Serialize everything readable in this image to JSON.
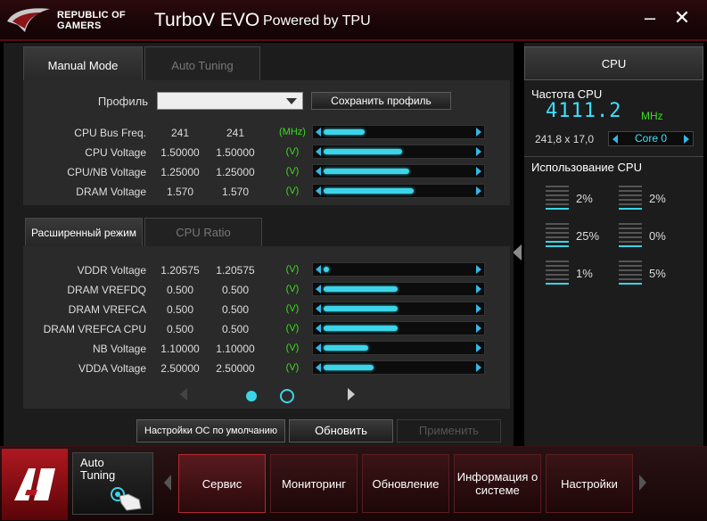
{
  "titlebar": {
    "brand": "REPUBLIC OF GAMERS",
    "brand_line1": "REPUBLIC OF",
    "brand_line2": "GAMERS",
    "title": "TurboV EVO",
    "subtitle": "Powered by TPU",
    "minimize": "–",
    "close": "✕"
  },
  "tabs": {
    "manual": "Manual Mode",
    "auto": "Auto Tuning",
    "advanced": "Расширенный режим",
    "cpu_ratio": "CPU Ratio"
  },
  "profile": {
    "label": "Профиль",
    "value": "",
    "save_button": "Сохранить профиль"
  },
  "voltages_top": [
    {
      "name": "CPU Bus Freq.",
      "value1": "241",
      "value2": "241",
      "unit": "(MHz)",
      "level": 0.28
    },
    {
      "name": "CPU Voltage",
      "value1": "1.50000",
      "value2": "1.50000",
      "unit": "(V)",
      "level": 0.53
    },
    {
      "name": "CPU/NB Voltage",
      "value1": "1.25000",
      "value2": "1.25000",
      "unit": "(V)",
      "level": 0.58
    },
    {
      "name": "DRAM Voltage",
      "value1": "1.570",
      "value2": "1.570",
      "unit": "(V)",
      "level": 0.61
    }
  ],
  "voltages_advanced": [
    {
      "name": "VDDR Voltage",
      "value1": "1.20575",
      "value2": "1.20575",
      "unit": "(V)",
      "level": 0.0
    },
    {
      "name": "DRAM VREFDQ",
      "value1": "0.500",
      "value2": "0.500",
      "unit": "(V)",
      "level": 0.5
    },
    {
      "name": "DRAM VREFCA",
      "value1": "0.500",
      "value2": "0.500",
      "unit": "(V)",
      "level": 0.5
    },
    {
      "name": "DRAM VREFCA CPU",
      "value1": "0.500",
      "value2": "0.500",
      "unit": "(V)",
      "level": 0.5
    },
    {
      "name": "NB Voltage",
      "value1": "1.10000",
      "value2": "1.10000",
      "unit": "(V)",
      "level": 0.3
    },
    {
      "name": "VDDA Voltage",
      "value1": "2.50000",
      "value2": "2.50000",
      "unit": "(V)",
      "level": 0.34
    }
  ],
  "buttons": {
    "defaults": "Настройки ОС по умолчанию",
    "refresh": "Обновить",
    "apply": "Применить"
  },
  "cpu_panel": {
    "tab": "CPU",
    "freq_label": "Частота CPU",
    "freq_value": "4111.2",
    "freq_unit": "MHz",
    "bus_ratio": "241,8 x 17,0",
    "core": "Core 0",
    "usage_label": "Использование CPU",
    "usage": [
      {
        "percent": "2%",
        "level": 1
      },
      {
        "percent": "2%",
        "level": 1
      },
      {
        "percent": "25%",
        "level": 2
      },
      {
        "percent": "0%",
        "level": 1
      },
      {
        "percent": "1%",
        "level": 1
      },
      {
        "percent": "5%",
        "level": 1
      }
    ]
  },
  "bottom": {
    "auto_tuning": "Auto\nTuning",
    "auto_line1": "Auto",
    "auto_line2": "Tuning",
    "nav": [
      {
        "label": "Сервис",
        "active": true
      },
      {
        "label": "Мониторинг",
        "active": false
      },
      {
        "label": "Обновление",
        "active": false
      },
      {
        "label": "Информация о системе",
        "active": false
      },
      {
        "label": "Настройки",
        "active": false
      }
    ]
  },
  "colors": {
    "accent": "#3cd4e8",
    "unit_green": "#3cdc20",
    "brand_red": "#b01820"
  }
}
